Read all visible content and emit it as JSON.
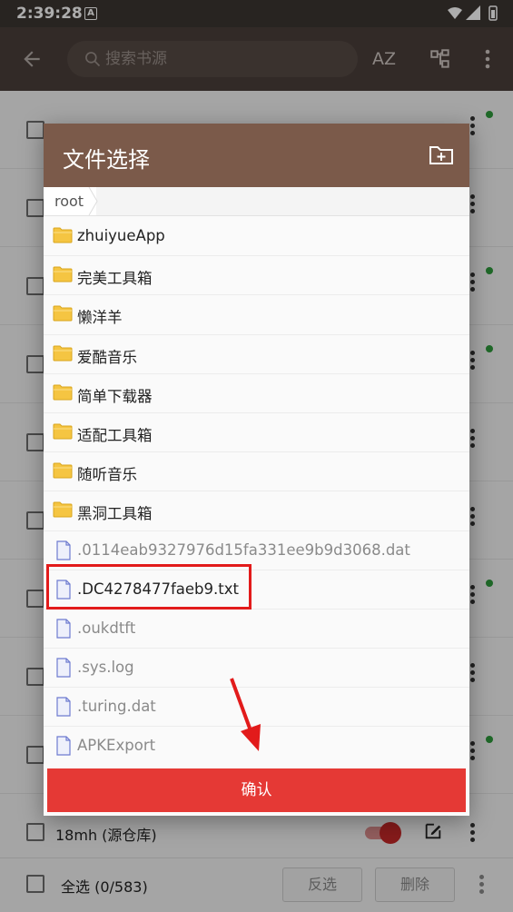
{
  "status_bar": {
    "time": "2:39:28",
    "notif_letter": "A"
  },
  "toolbar": {
    "search_placeholder": "搜索书源",
    "sort_label": "AZ"
  },
  "background_list": {
    "last_item_name": "18mh (源仓库)",
    "select_all_label": "全选 (0/583)",
    "invert_label": "反选",
    "delete_label": "删除"
  },
  "dialog": {
    "title": "文件选择",
    "breadcrumb": "root",
    "confirm_label": "确认",
    "items": [
      {
        "name": "zhuiyueApp",
        "type": "folder"
      },
      {
        "name": "完美工具箱",
        "type": "folder"
      },
      {
        "name": "懒洋羊",
        "type": "folder"
      },
      {
        "name": "爱酷音乐",
        "type": "folder"
      },
      {
        "name": "简单下载器",
        "type": "folder"
      },
      {
        "name": "适配工具箱",
        "type": "folder"
      },
      {
        "name": "随听音乐",
        "type": "folder"
      },
      {
        "name": "黑洞工具箱",
        "type": "folder"
      },
      {
        "name": ".0114eab9327976d15fa331ee9b9d3068.dat",
        "type": "file"
      },
      {
        "name": ".DC4278477faeb9.txt",
        "type": "file",
        "highlighted": true
      },
      {
        "name": ".oukdtft",
        "type": "file"
      },
      {
        "name": ".sys.log",
        "type": "file"
      },
      {
        "name": ".turing.dat",
        "type": "file"
      },
      {
        "name": "APKExport",
        "type": "file"
      }
    ]
  },
  "colors": {
    "header": "#7b5a4a",
    "confirm": "#e53935",
    "highlight": "#e21b1b",
    "folder": "#f5c542",
    "file_icon": "#5c6bc0"
  }
}
